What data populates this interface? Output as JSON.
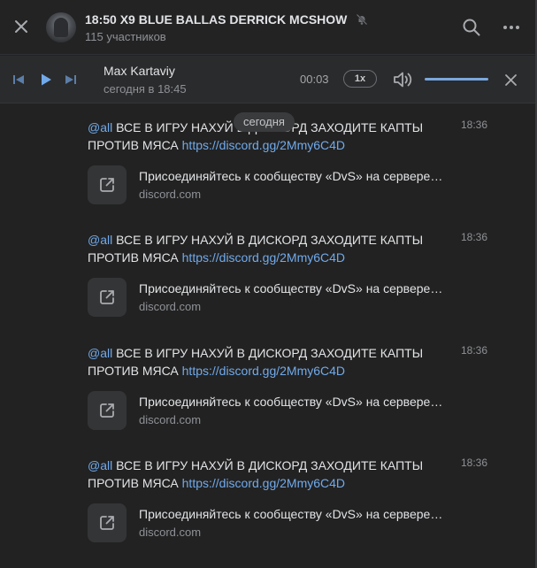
{
  "header": {
    "title": "18:50 X9 BLUE BALLAS DERRICK MCSHOW",
    "subtitle": "115 участников"
  },
  "player": {
    "artist": "Max Kartaviy",
    "time": "сегодня в 18:45",
    "elapsed": "00:03",
    "speed": "1x",
    "volume_level": 1.0
  },
  "feed": {
    "date_pill": "сегодня",
    "messages": [
      {
        "mention": "@all",
        "text_before": " ВСЕ В ИГРУ НАХУЙ В ДИСКОРД ЗАХОДИТЕ КАПТЫ ПРОТИВ МЯСА ",
        "link": "https://discord.gg/2Mmy6C4D",
        "time": "18:36",
        "snippet_title": "Присоединяйтесь к сообществу «DvS» на сервере Discord!",
        "snippet_domain": "discord.com"
      },
      {
        "mention": "@all",
        "text_before": " ВСЕ В ИГРУ НАХУЙ В ДИСКОРД ЗАХОДИТЕ КАПТЫ ПРОТИВ МЯСА ",
        "link": "https://discord.gg/2Mmy6C4D",
        "time": "18:36",
        "snippet_title": "Присоединяйтесь к сообществу «DvS» на сервере Discord!",
        "snippet_domain": "discord.com"
      },
      {
        "mention": "@all",
        "text_before": " ВСЕ В ИГРУ НАХУЙ В ДИСКОРД ЗАХОДИТЕ КАПТЫ ПРОТИВ МЯСА ",
        "link": "https://discord.gg/2Mmy6C4D",
        "time": "18:36",
        "snippet_title": "Присоединяйтесь к сообществу «DvS» на сервере Discord!",
        "snippet_domain": "discord.com"
      },
      {
        "mention": "@all",
        "text_before": " ВСЕ В ИГРУ НАХУЙ В ДИСКОРД ЗАХОДИТЕ КАПТЫ ПРОТИВ МЯСА ",
        "link": "https://discord.gg/2Mmy6C4D",
        "time": "18:36",
        "snippet_title": "Присоединяйтесь к сообществу «DvS» на сервере Discord!",
        "snippet_domain": "discord.com"
      }
    ]
  },
  "colors": {
    "accent": "#71aaeb",
    "background": "#222222",
    "text": "#e1e3e6",
    "muted": "#8e9196"
  },
  "icons": {
    "close": "close-icon",
    "muted": "bell-muted-icon",
    "search": "search-icon",
    "more": "more-dots-icon",
    "prev": "previous-track-icon",
    "play": "play-icon",
    "next": "next-track-icon",
    "volume": "volume-icon",
    "external": "external-link-icon"
  }
}
